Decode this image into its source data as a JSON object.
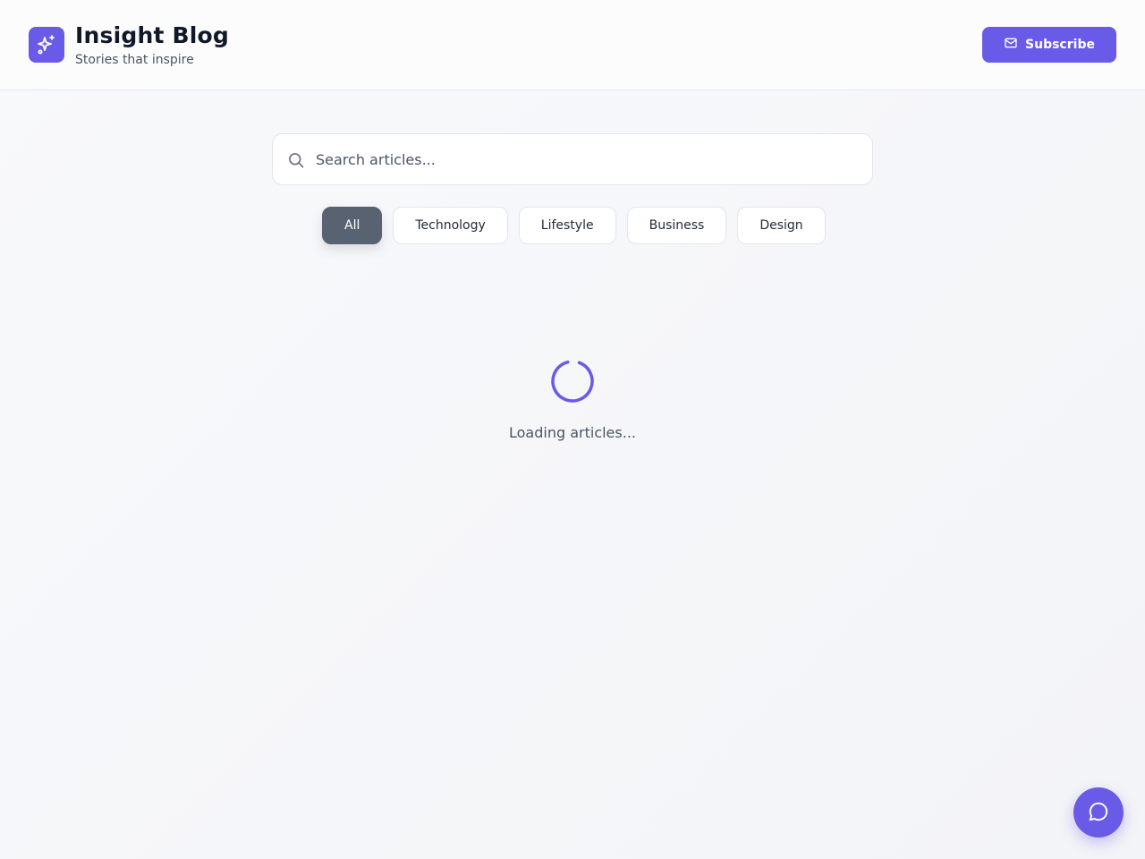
{
  "brand": {
    "title": "Insight Blog",
    "subtitle": "Stories that inspire",
    "logo_icon": "sparkles-icon"
  },
  "header": {
    "subscribe_label": "Subscribe",
    "subscribe_icon": "mail-icon"
  },
  "search": {
    "placeholder": "Search articles...",
    "value": "",
    "icon": "search-icon"
  },
  "filters": {
    "active": "All",
    "items": [
      {
        "label": "All"
      },
      {
        "label": "Technology"
      },
      {
        "label": "Lifestyle"
      },
      {
        "label": "Business"
      },
      {
        "label": "Design"
      }
    ]
  },
  "status": {
    "loading_text": "Loading articles..."
  },
  "chat": {
    "icon": "chat-bubble-icon"
  },
  "colors": {
    "accent": "#6a5ae8",
    "active_chip": "#596270",
    "background": "#f5f6f8"
  }
}
